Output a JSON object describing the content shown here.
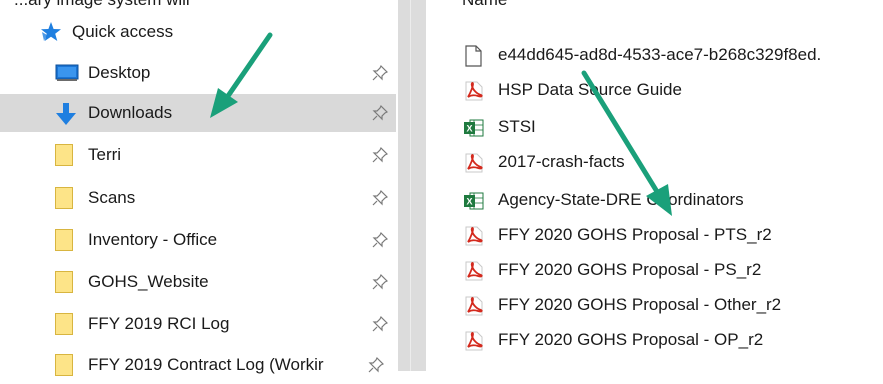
{
  "top_clip": {
    "left_text": "...ary image system will",
    "right_text": "Name"
  },
  "sidebar": {
    "quick_access": {
      "label": "Quick access",
      "icon": "star-icon",
      "pinned": false
    },
    "items": [
      {
        "label": "Desktop",
        "icon": "desktop-icon",
        "pinned": true,
        "selected": false
      },
      {
        "label": "Downloads",
        "icon": "download-arrow-icon",
        "pinned": true,
        "selected": true
      },
      {
        "label": "Terri",
        "icon": "folder-icon",
        "pinned": true,
        "selected": false
      },
      {
        "label": "Scans",
        "icon": "folder-icon",
        "pinned": true,
        "selected": false
      },
      {
        "label": "Inventory - Office",
        "icon": "folder-icon",
        "pinned": true,
        "selected": false
      },
      {
        "label": "GOHS_Website",
        "icon": "folder-icon",
        "pinned": true,
        "selected": false
      },
      {
        "label": "FFY 2019 RCI Log",
        "icon": "folder-icon",
        "pinned": true,
        "selected": false
      },
      {
        "label": "FFY 2019 Contract Log (Workir",
        "icon": "folder-icon",
        "pinned": true,
        "selected": false
      }
    ]
  },
  "files": [
    {
      "name": "e44dd645-ad8d-4533-ace7-b268c329f8ed.",
      "icon": "blank-file-icon"
    },
    {
      "name": "HSP Data Source Guide",
      "icon": "pdf-file-icon"
    },
    {
      "name": "STSI",
      "icon": "excel-file-icon"
    },
    {
      "name": "2017-crash-facts",
      "icon": "pdf-file-icon"
    },
    {
      "name": "Agency-State-DRE Coordinators",
      "icon": "excel-file-icon"
    },
    {
      "name": "FFY 2020 GOHS Proposal - PTS_r2",
      "icon": "pdf-file-icon"
    },
    {
      "name": "FFY 2020 GOHS Proposal - PS_r2",
      "icon": "pdf-file-icon"
    },
    {
      "name": "FFY 2020 GOHS Proposal - Other_r2",
      "icon": "pdf-file-icon"
    },
    {
      "name": "FFY 2020 GOHS Proposal - OP_r2",
      "icon": "pdf-file-icon"
    }
  ],
  "colors": {
    "selected_bg": "#d9d9d9",
    "annotation_arrow": "#1aa07a",
    "pdf_red": "#d42a1e",
    "excel_green": "#1f7a3f",
    "folder_yellow": "#fde488",
    "quick_access_blue": "#1f7fe0"
  }
}
